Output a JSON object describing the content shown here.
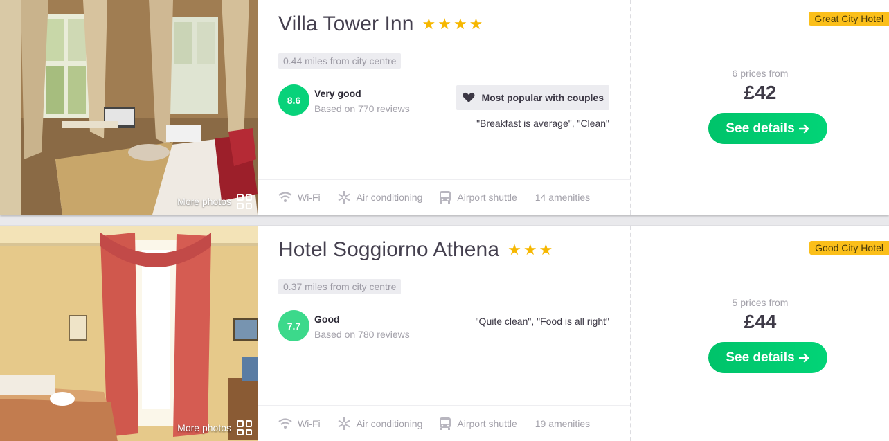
{
  "results": [
    {
      "name": "Villa Tower Inn",
      "stars": "★★★★",
      "distance": "0.44 miles from city centre",
      "score": "8.6",
      "score_color": "#08d27a",
      "rating_word": "Very good",
      "review_count": "Based on 770 reviews",
      "popular_label": "Most popular with couples",
      "quote": "\"Breakfast is average\", \"Clean\"",
      "amenities": [
        "Wi-Fi",
        "Air conditioning",
        "Airport shuttle"
      ],
      "amenity_count": "14 amenities",
      "more_photos": "More photos",
      "tag": "Great City Hotel",
      "prices_from": "6 prices from",
      "price": "£42",
      "cta": "See details"
    },
    {
      "name": "Hotel Soggiorno Athena",
      "stars": "★★★",
      "distance": "0.37 miles from city centre",
      "score": "7.7",
      "score_color": "#3cd98b",
      "rating_word": "Good",
      "review_count": "Based on 780 reviews",
      "quote": "\"Quite clean\", \"Food is all right\"",
      "amenities": [
        "Wi-Fi",
        "Air conditioning",
        "Airport shuttle"
      ],
      "amenity_count": "19 amenities",
      "more_photos": "More photos",
      "tag": "Good City Hotel",
      "prices_from": "5 prices from",
      "price": "£44",
      "cta": "See details"
    }
  ],
  "icons": {
    "wifi": "wifi-icon",
    "ac": "snowflake-icon",
    "shuttle": "bus-icon",
    "heart": "heart-icon",
    "arrow": "arrow-right-icon",
    "gallery": "grid-icon"
  }
}
